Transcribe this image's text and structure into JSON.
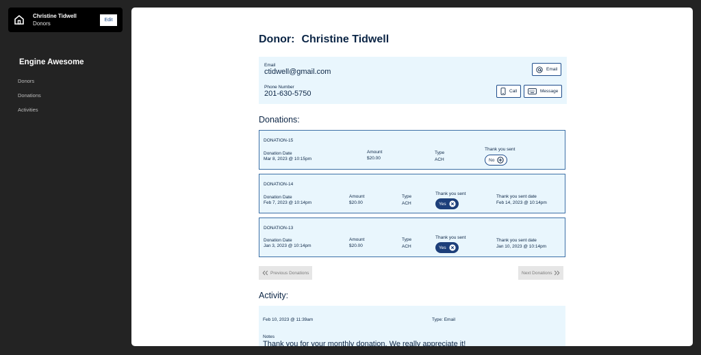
{
  "sidebar": {
    "header": {
      "name": "Christine Tidwell",
      "subtitle": "Donors",
      "edit_label": "Edit"
    },
    "brand": "Engine Awesome",
    "nav": [
      {
        "label": "Donors"
      },
      {
        "label": "Donations"
      },
      {
        "label": "Activities"
      }
    ]
  },
  "donor": {
    "title_prefix": "Donor:",
    "name": "Christine Tidwell",
    "email_label": "Email",
    "email": "ctidwell@gmail.com",
    "phone_label": "Phone Number",
    "phone": "201-630-5750",
    "buttons": {
      "email": "Email",
      "call": "Call",
      "message": "Message"
    }
  },
  "donations": {
    "title": "Donations:",
    "items": [
      {
        "id": "DONATION-15",
        "date_label": "Donation Date",
        "date": "Mar 8, 2023 @ 10:15pm",
        "amount_label": "Amount",
        "amount": "$20.00",
        "type_label": "Type",
        "type": "ACH",
        "thanks_label": "Thank you sent",
        "thanks": "No"
      },
      {
        "id": "DONATION-14",
        "date_label": "Donation Date",
        "date": "Feb 7, 2023 @ 10:14pm",
        "amount_label": "Amount",
        "amount": "$20.00",
        "type_label": "Type",
        "type": "ACH",
        "thanks_label": "Thank you sent",
        "thanks": "Yes",
        "thanks_date_label": "Thank you sent date",
        "thanks_date": "Feb 14, 2023 @ 10:14pm"
      },
      {
        "id": "DONATION-13",
        "date_label": "Donation Date",
        "date": "Jan 3, 2023 @ 10:14pm",
        "amount_label": "Amount",
        "amount": "$20.00",
        "type_label": "Type",
        "type": "ACH",
        "thanks_label": "Thank you sent",
        "thanks": "Yes",
        "thanks_date_label": "Thank you sent date",
        "thanks_date": "Jan 10, 2023 @ 10:14pm"
      }
    ],
    "prev_label": "Previous Donations",
    "next_label": "Next Donations"
  },
  "activity": {
    "title": "Activity:",
    "items": [
      {
        "date": "Feb 10, 2023 @ 11:39am",
        "type": "Type: Email",
        "notes_label": "Notes",
        "notes": "Thank you for your monthly donation. We really appreciate it!"
      }
    ]
  },
  "icons": {
    "home": "home-icon",
    "at": "at-icon",
    "phone": "phone-icon",
    "keyboard": "keyboard-icon",
    "plus_circle": "plus-circle-icon",
    "x_circle": "x-circle-icon",
    "chevrons_left": "chevrons-left-icon",
    "chevrons_right": "chevrons-right-icon"
  },
  "colors": {
    "primary": "#1d3f7a",
    "panel_bg": "#e9f6fd",
    "app_bg": "#232323",
    "text": "#0b2545"
  }
}
